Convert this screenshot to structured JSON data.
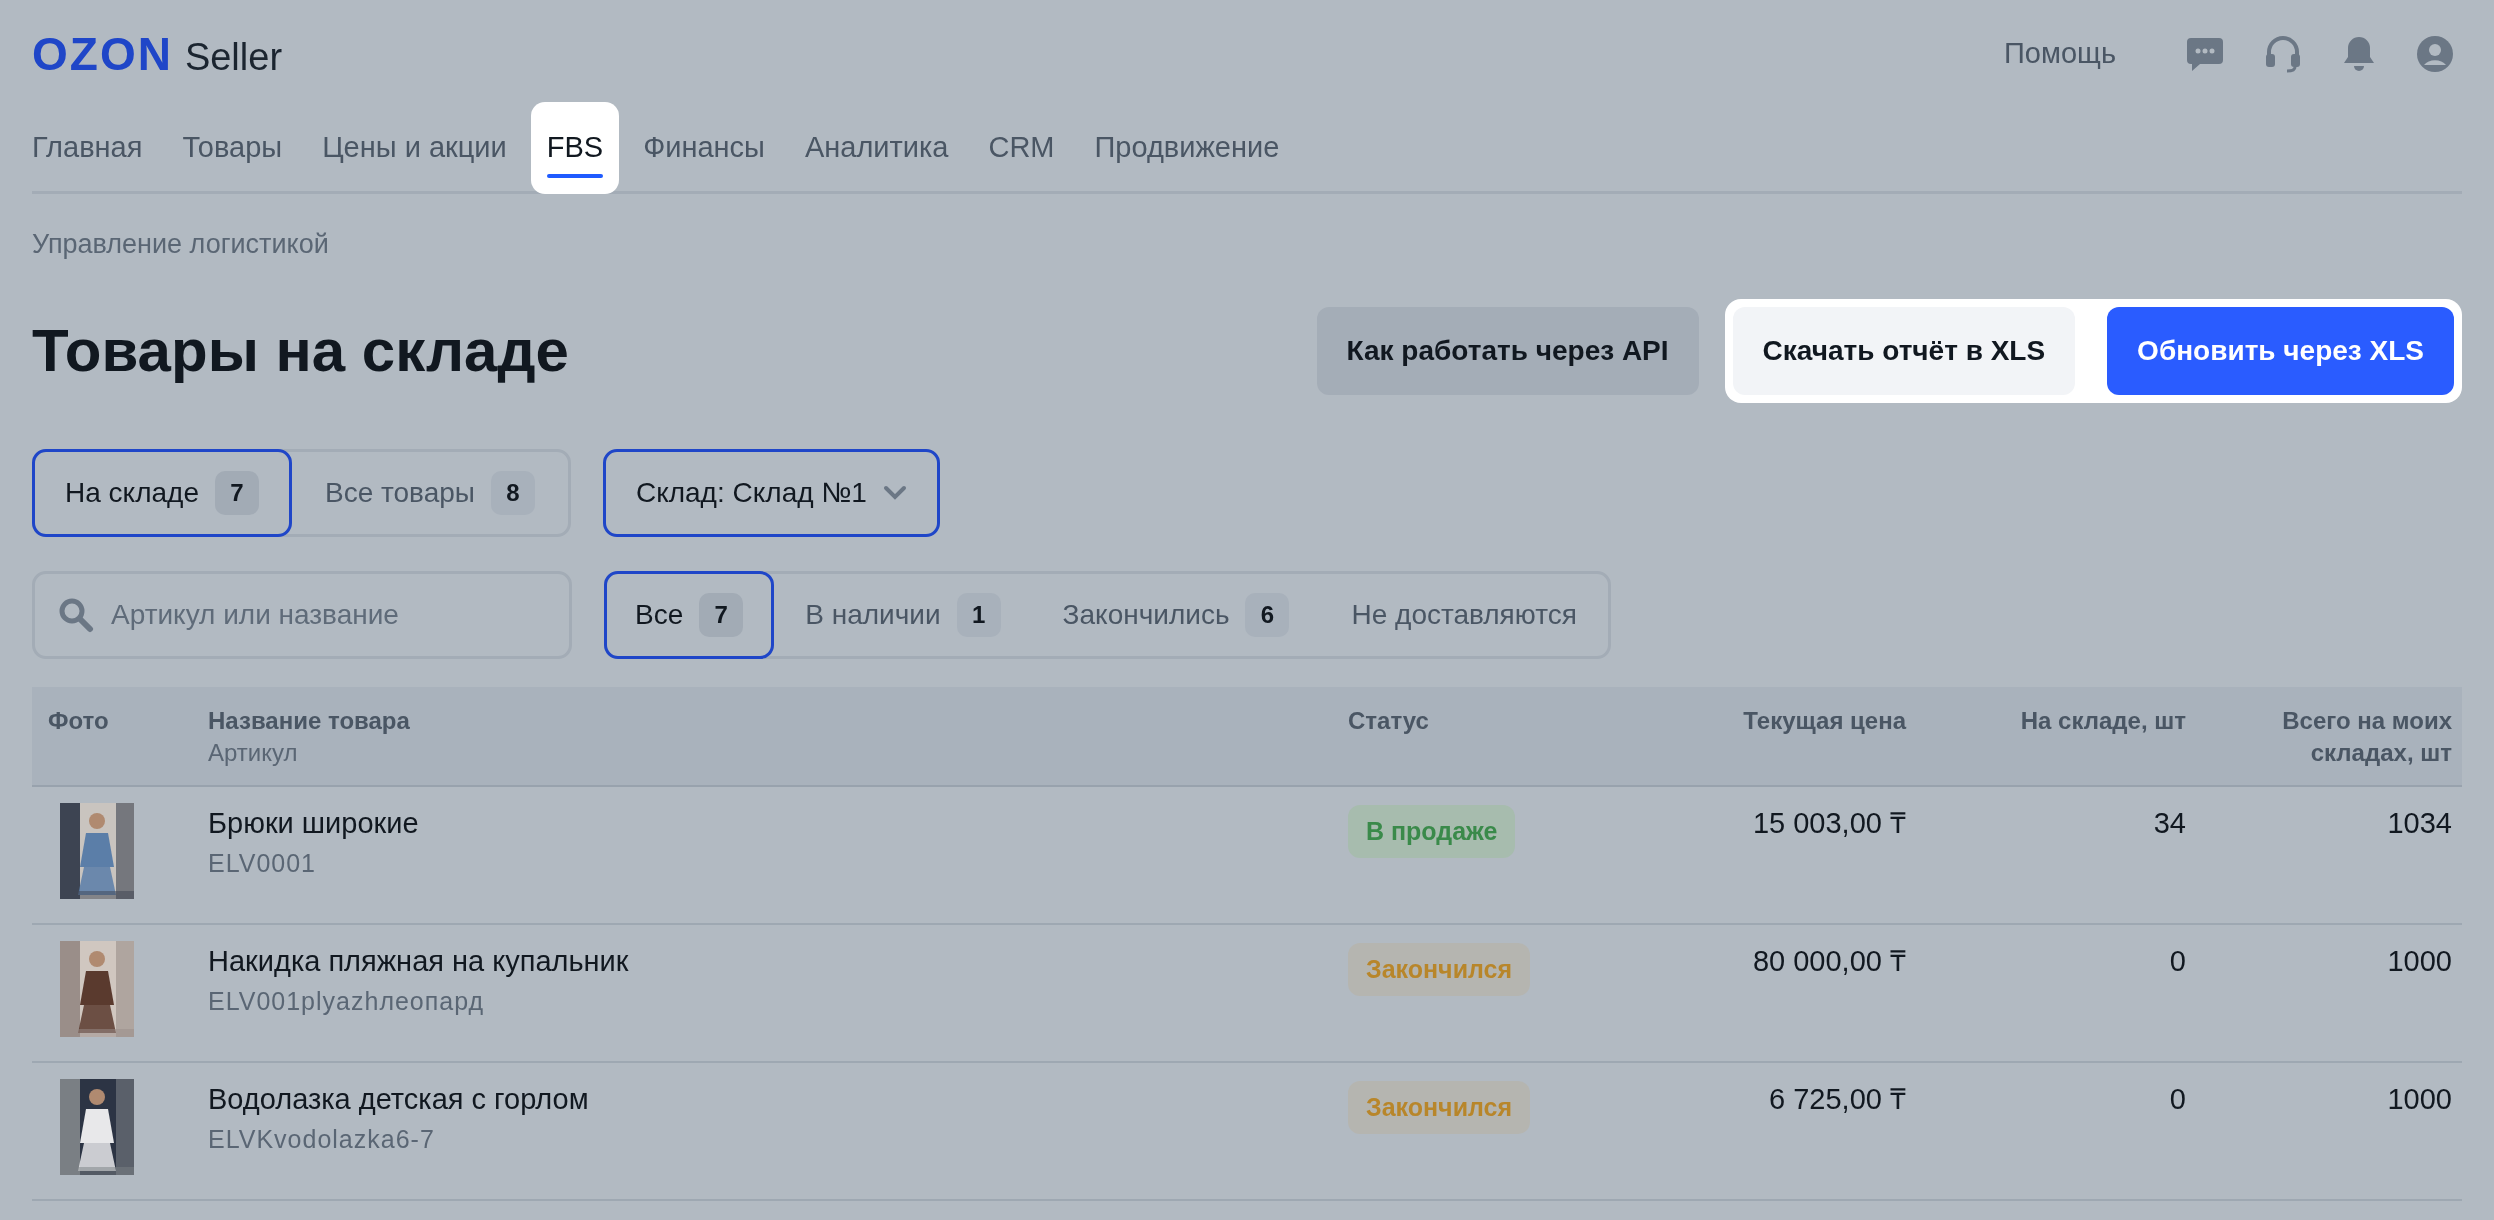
{
  "header": {
    "logo": "OZON",
    "logo_suffix": "Seller",
    "help": "Помощь"
  },
  "nav": [
    {
      "label": "Главная",
      "selected": false,
      "highlighted": false
    },
    {
      "label": "Товары",
      "selected": false,
      "highlighted": false
    },
    {
      "label": "Цены и акции",
      "selected": false,
      "highlighted": false
    },
    {
      "label": "FBS",
      "selected": true,
      "highlighted": true
    },
    {
      "label": "Финансы",
      "selected": false,
      "highlighted": false
    },
    {
      "label": "Аналитика",
      "selected": false,
      "highlighted": false
    },
    {
      "label": "CRM",
      "selected": false,
      "highlighted": false
    },
    {
      "label": "Продвижение",
      "selected": false,
      "highlighted": false
    }
  ],
  "breadcrumb": "Управление логистикой",
  "title": "Товары на складе",
  "actions": [
    {
      "label": "Как работать через API",
      "kind": "secondary",
      "highlighted": false
    },
    {
      "label": "Скачать отчёт в XLS",
      "kind": "secondary",
      "highlighted": true
    },
    {
      "label": "Обновить через XLS",
      "kind": "primary",
      "highlighted": true
    }
  ],
  "scope_tabs": [
    {
      "label": "На складе",
      "count": "7",
      "selected": true
    },
    {
      "label": "Все товары",
      "count": "8",
      "selected": false
    }
  ],
  "warehouse_select": {
    "label": "Склад: Склад №1",
    "focused": true
  },
  "search": {
    "placeholder": "Артикул или название"
  },
  "status_filters": [
    {
      "label": "Все",
      "count": "7",
      "selected": true
    },
    {
      "label": "В наличии",
      "count": "1",
      "selected": false
    },
    {
      "label": "Закончились",
      "count": "6",
      "selected": false
    },
    {
      "label": "Не доставляются",
      "selected": false
    }
  ],
  "table": {
    "columns": [
      {
        "label": "Фото"
      },
      {
        "label": "Название товара",
        "sublabel": "Артикул"
      },
      {
        "label": "Статус"
      },
      {
        "label": "Текущая цена"
      },
      {
        "label": "На складе, шт"
      },
      {
        "label": "Всего на моих складах, шт"
      }
    ],
    "rows": [
      {
        "name": "Брюки широкие",
        "sku": "ELV0001",
        "status": {
          "label": "В продаже",
          "kind": "on_sale"
        },
        "price": "15 003,00 ₸",
        "stock": "34",
        "total": "1034"
      },
      {
        "name": "Накидка пляжная на купальник",
        "sku": "ELV001plyazhлеопард",
        "status": {
          "label": "Закончился",
          "kind": "out"
        },
        "price": "80 000,00 ₸",
        "stock": "0",
        "total": "1000"
      },
      {
        "name": "Водолазка детская с горлом",
        "sku": "ELVKvodolazka6-7",
        "status": {
          "label": "Закончился",
          "kind": "out"
        },
        "price": "6 725,00 ₸",
        "stock": "0",
        "total": "1000"
      }
    ]
  }
}
